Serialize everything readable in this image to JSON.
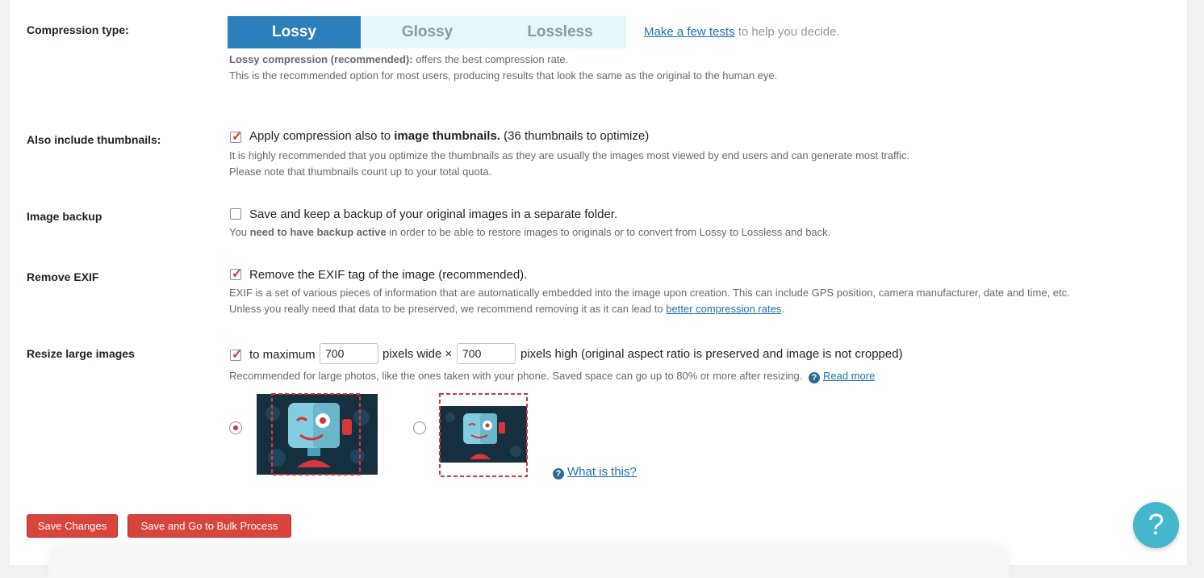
{
  "compression": {
    "label": "Compression type:",
    "options": [
      "Lossy",
      "Glossy",
      "Lossless"
    ],
    "active": "Lossy",
    "tests_link": "Make a few tests",
    "tests_suffix": "to help you decide.",
    "desc_bold": "Lossy compression (recommended):",
    "desc_rest": "offers the best compression rate.",
    "desc_line2": "This is the recommended option for most users, producing results that look the same as the original to the human eye."
  },
  "thumbnails": {
    "label": "Also include thumbnails:",
    "checked": true,
    "text_pre": "Apply compression also to",
    "text_bold": "image thumbnails.",
    "count": "(36 thumbnails to optimize)",
    "desc1": "It is highly recommended that you optimize the thumbnails as they are usually the images most viewed by end users and can generate most traffic.",
    "desc2": "Please note that thumbnails count up to your total quota."
  },
  "backup": {
    "label": "Image backup",
    "checked": false,
    "text": "Save and keep a backup of your original images in a separate folder.",
    "desc_pre": "You",
    "desc_bold": "need to have backup active",
    "desc_rest": "in order to be able to restore images to originals or to convert from Lossy to Lossless and back."
  },
  "exif": {
    "label": "Remove EXIF",
    "checked": true,
    "text": "Remove the EXIF tag of the image (recommended).",
    "desc1": "EXIF is a set of various pieces of information that are automatically embedded into the image upon creation. This can include GPS position, camera manufacturer, date and time, etc.",
    "desc2_pre": "Unless you really need that data to be preserved, we recommend removing it as it can lead to",
    "desc2_link": "better compression rates",
    "desc2_end": "."
  },
  "resize": {
    "label": "Resize large images",
    "checked": true,
    "to_max": "to maximum",
    "width": "700",
    "wide_text": "pixels wide ×",
    "height": "700",
    "high_text": "pixels high (original aspect ratio is preserved and image is not cropped)",
    "desc": "Recommended for large photos, like the ones taken with your phone. Saved space can go up to 80% or more after resizing.",
    "read_more": "Read more",
    "what_is_this": "What is this?",
    "selected_mode": "cover"
  },
  "buttons": {
    "save": "Save Changes",
    "bulk": "Save and Go to Bulk Process"
  },
  "help": {
    "glyph": "?"
  },
  "colors": {
    "accent": "#2b7fbb",
    "button": "#d8453d",
    "help": "#44b7cc",
    "link": "#2271b1"
  }
}
